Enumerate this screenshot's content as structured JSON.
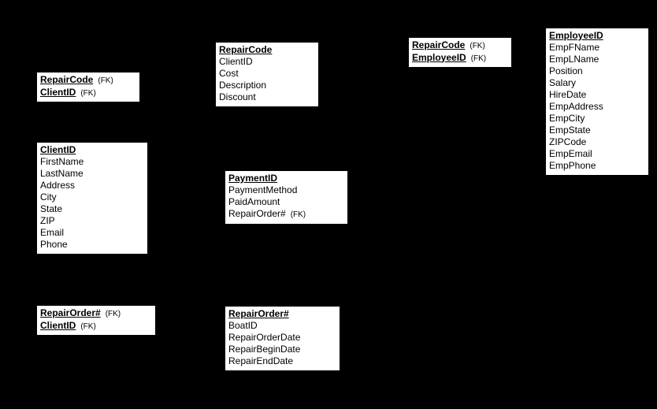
{
  "tables": {
    "client_repair": {
      "rows": [
        {
          "name": "RepairCode",
          "pk": true,
          "fk": true
        },
        {
          "name": "ClientID",
          "pk": true,
          "fk": true
        }
      ]
    },
    "repair": {
      "rows": [
        {
          "name": "RepairCode",
          "pk": true
        },
        {
          "name": "ClientID"
        },
        {
          "name": "Cost"
        },
        {
          "name": "Description"
        },
        {
          "name": "Discount"
        }
      ]
    },
    "emp_repair": {
      "rows": [
        {
          "name": "RepairCode",
          "pk": true,
          "fk": true
        },
        {
          "name": "EmployeeID",
          "pk": true,
          "fk": true
        }
      ]
    },
    "employee": {
      "rows": [
        {
          "name": "EmployeeID",
          "pk": true
        },
        {
          "name": "EmpFName"
        },
        {
          "name": "EmpLName"
        },
        {
          "name": "Position"
        },
        {
          "name": "Salary"
        },
        {
          "name": "HireDate"
        },
        {
          "name": "EmpAddress"
        },
        {
          "name": "EmpCity"
        },
        {
          "name": "EmpState"
        },
        {
          "name": "ZIPCode"
        },
        {
          "name": "EmpEmail"
        },
        {
          "name": "EmpPhone"
        }
      ]
    },
    "client": {
      "rows": [
        {
          "name": "ClientID",
          "pk": true
        },
        {
          "name": "FirstName"
        },
        {
          "name": "LastName"
        },
        {
          "name": "Address"
        },
        {
          "name": "City"
        },
        {
          "name": "State"
        },
        {
          "name": "ZIP"
        },
        {
          "name": "Email"
        },
        {
          "name": "Phone"
        }
      ]
    },
    "payment": {
      "rows": [
        {
          "name": "PaymentID",
          "pk": true
        },
        {
          "name": "PaymentMethod"
        },
        {
          "name": "PaidAmount"
        },
        {
          "name": "RepairOrder#",
          "fk": true
        }
      ]
    },
    "client_order": {
      "rows": [
        {
          "name": "RepairOrder#",
          "pk": true,
          "fk": true
        },
        {
          "name": "ClientID",
          "pk": true,
          "fk": true
        }
      ]
    },
    "repair_order": {
      "rows": [
        {
          "name": "RepairOrder#",
          "pk": true
        },
        {
          "name": "BoatID"
        },
        {
          "name": "RepairOrderDate"
        },
        {
          "name": "RepairBeginDate"
        },
        {
          "name": "RepairEndDate"
        }
      ]
    }
  },
  "fk_label": "(FK)"
}
